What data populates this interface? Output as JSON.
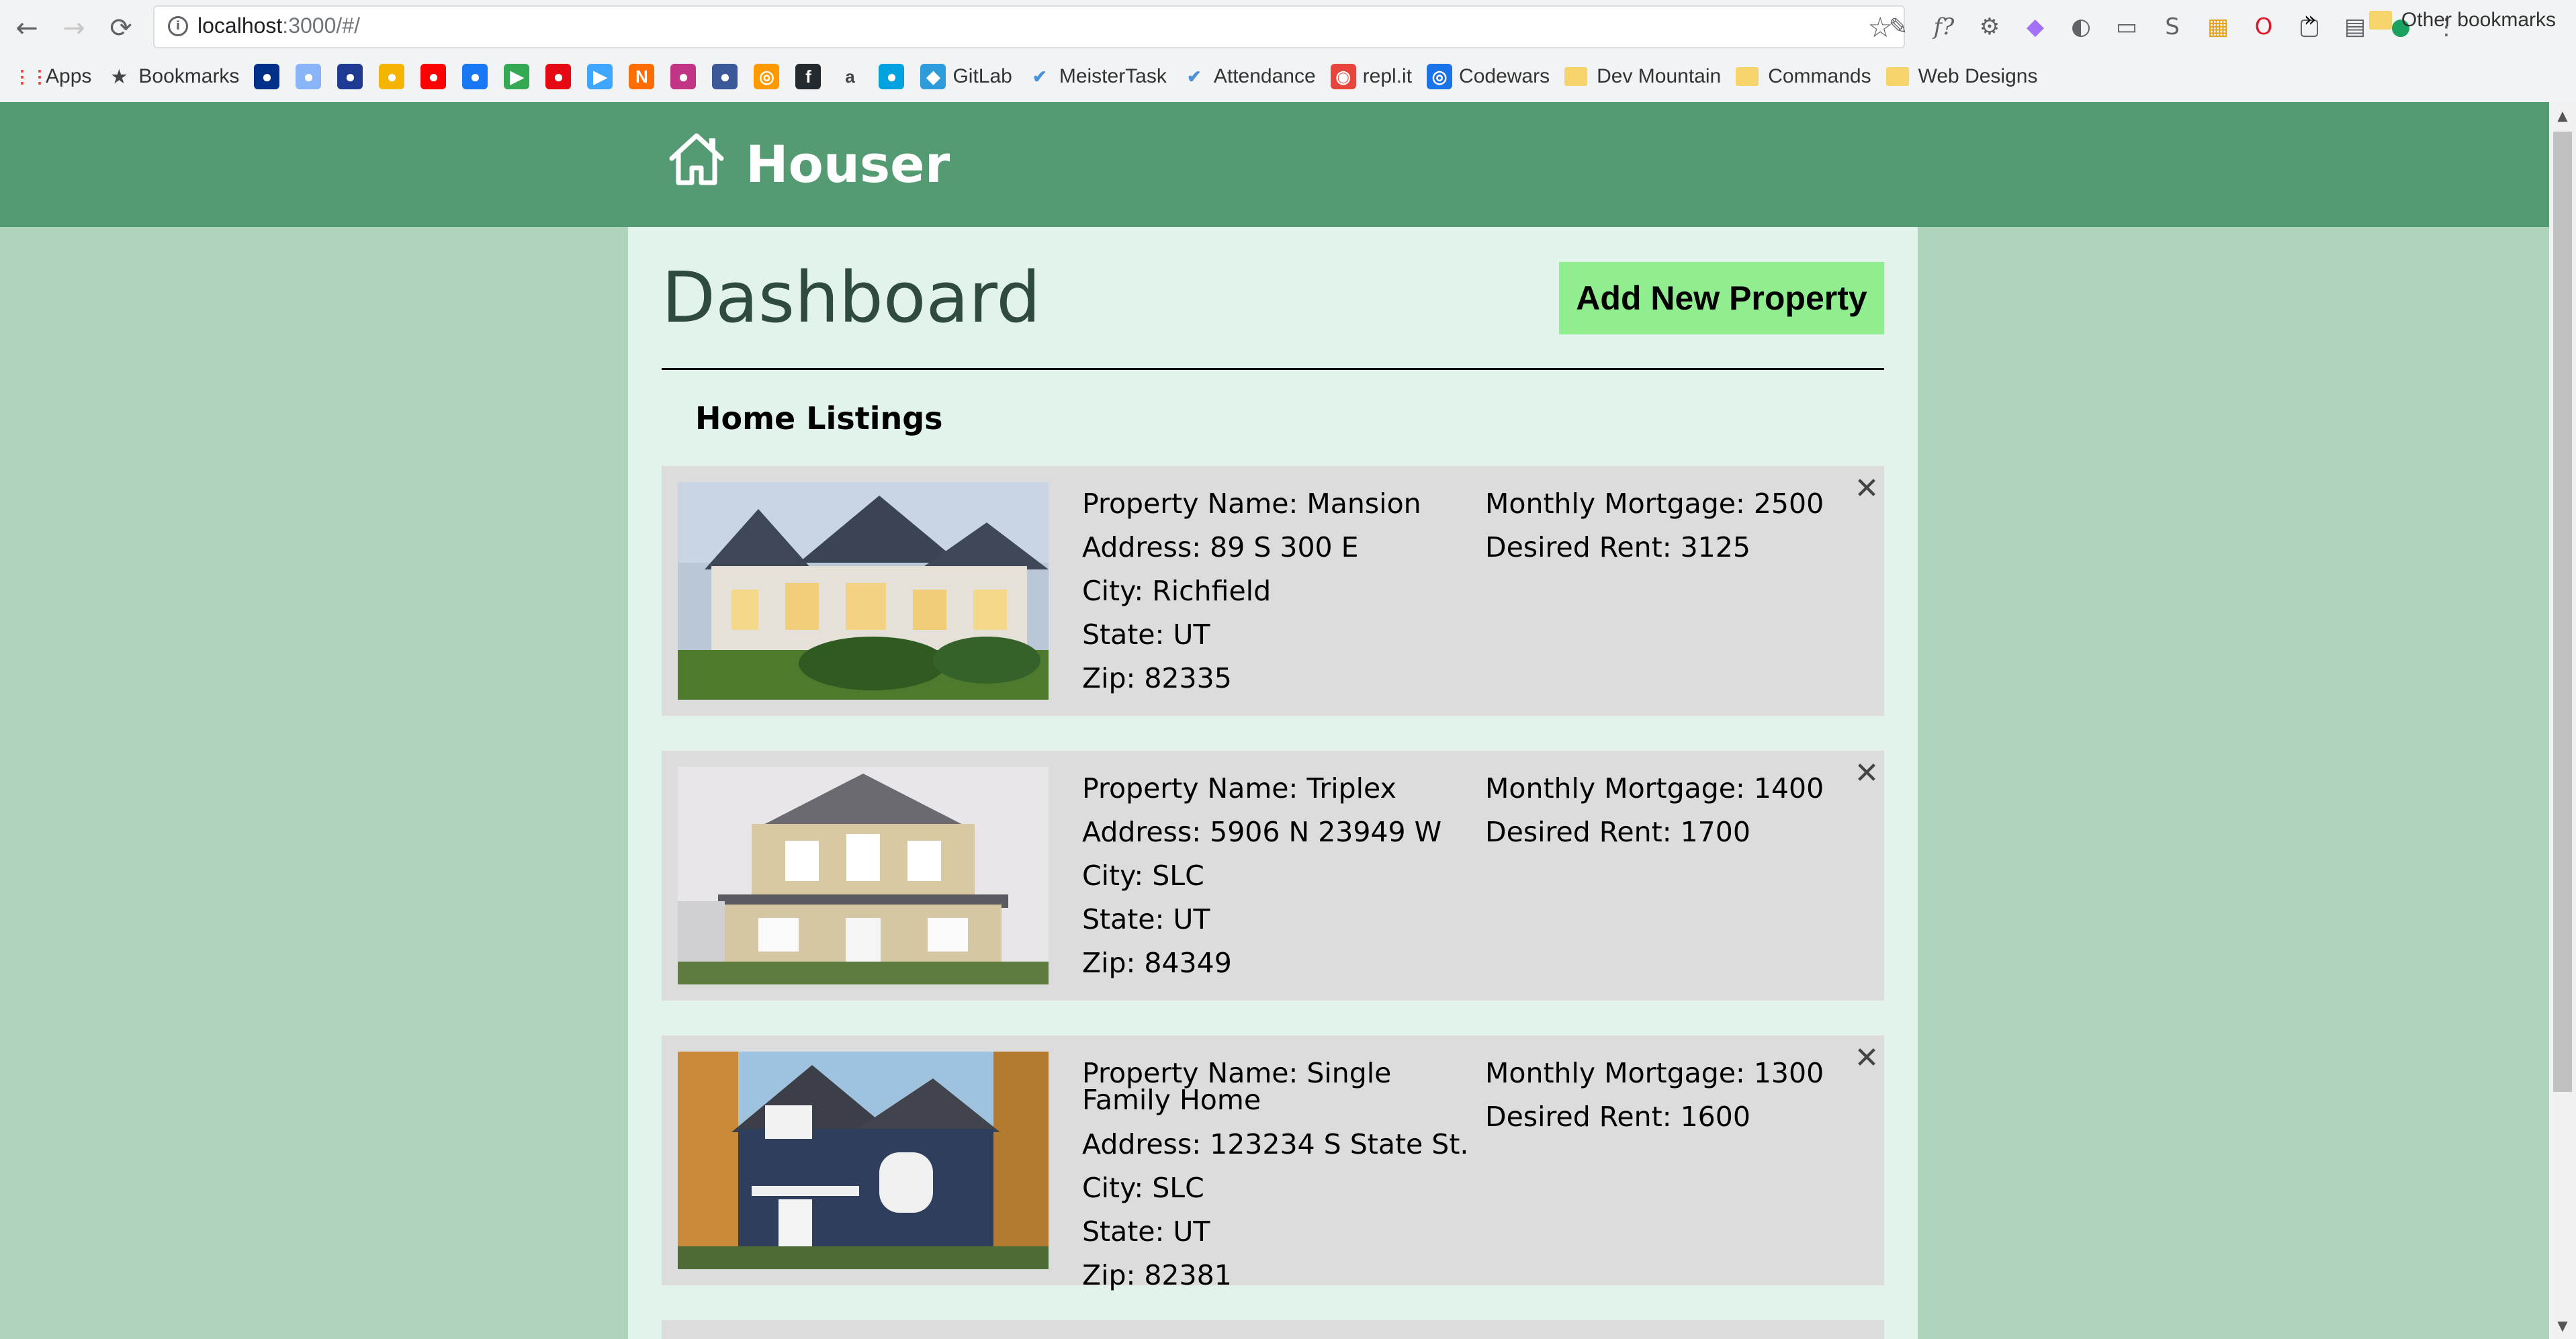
{
  "browser": {
    "url_host": "localhost",
    "url_path": ":3000/#/",
    "bookmarks": [
      {
        "label": "Apps",
        "icon": "apps-grid-icon"
      },
      {
        "label": "Bookmarks",
        "icon": "star-icon"
      },
      {
        "label": "",
        "icon": "bookmark-icon"
      },
      {
        "label": "",
        "icon": "bookmark-icon"
      },
      {
        "label": "",
        "icon": "bookmark-icon"
      },
      {
        "label": "",
        "icon": "bookmark-icon"
      },
      {
        "label": "",
        "icon": "bookmark-icon"
      },
      {
        "label": "",
        "icon": "bookmark-icon"
      },
      {
        "label": "",
        "icon": "youtube-icon"
      },
      {
        "label": "",
        "icon": "bookmark-icon"
      },
      {
        "label": "",
        "icon": "play-store-icon"
      },
      {
        "label": "",
        "icon": "netflix-icon"
      },
      {
        "label": "",
        "icon": "bookmark-icon"
      },
      {
        "label": "",
        "icon": "bookmark-icon"
      },
      {
        "label": "",
        "icon": "instagram-icon"
      },
      {
        "label": "",
        "icon": "facebook-icon"
      },
      {
        "label": "",
        "icon": "amazon-icon"
      },
      {
        "label": "",
        "icon": "github-icon"
      },
      {
        "label": "GitLab",
        "icon": "gitlab-icon"
      },
      {
        "label": "MeisterTask",
        "icon": "check-icon"
      },
      {
        "label": "Attendance",
        "icon": "check-icon"
      },
      {
        "label": "repl.it",
        "icon": "replit-icon"
      },
      {
        "label": "Codewars",
        "icon": "codewars-icon"
      },
      {
        "label": "Dev Mountain",
        "icon": "folder-icon"
      },
      {
        "label": "Commands",
        "icon": "folder-icon"
      },
      {
        "label": "Web Designs",
        "icon": "folder-icon"
      }
    ],
    "more_label": "»",
    "other_bookmarks": "Other bookmarks"
  },
  "header": {
    "title": "Houser",
    "logo_icon": "house-icon"
  },
  "dashboard": {
    "title": "Dashboard",
    "add_button": "Add New Property",
    "listings_heading": "Home Listings"
  },
  "listings": [
    {
      "name": "Property Name: Mansion",
      "address": "Address: 89 S 300 E",
      "city": "City: Richfield",
      "state": "State: UT",
      "zip": "Zip: 82335",
      "mortgage": "Monthly Mortgage: 2500",
      "rent": "Desired Rent: 3125",
      "close": "✕"
    },
    {
      "name": "Property Name: Triplex",
      "address": "Address: 5906 N 23949 W",
      "city": "City: SLC",
      "state": "State: UT",
      "zip": "Zip: 84349",
      "mortgage": "Monthly Mortgage: 1400",
      "rent": "Desired Rent: 1700",
      "close": "✕"
    },
    {
      "name": "Property Name: Single Family Home",
      "address": "Address: 123234 S State St.",
      "city": "City: SLC",
      "state": "State: UT",
      "zip": "Zip: 82381",
      "mortgage": "Monthly Mortgage: 1300",
      "rent": "Desired Rent: 1600",
      "close": "✕"
    }
  ],
  "colors": {
    "header_bg": "#549a73",
    "page_bg": "#aed5bc",
    "panel_bg": "#e2f3eb",
    "card_bg": "#dcdcdc",
    "button_bg": "#90ee90"
  }
}
